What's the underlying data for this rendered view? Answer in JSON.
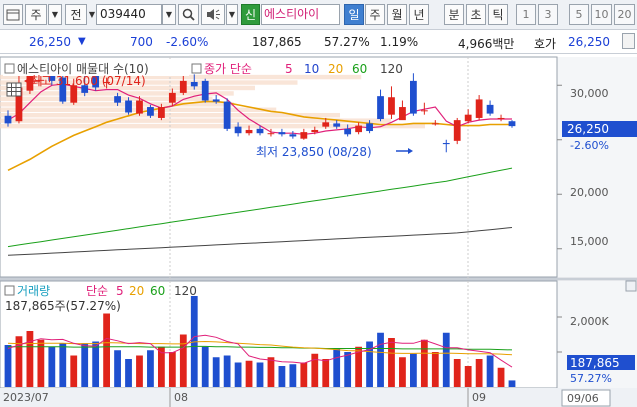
{
  "toolbar": {
    "chart_icon": "chart-window-icon",
    "type_label": "주",
    "period_label": "전",
    "code": "039440",
    "sin_label": "신",
    "stock_name": "에스티아이",
    "period_buttons": [
      "일",
      "주",
      "월",
      "년",
      "분",
      "초",
      "틱"
    ],
    "selected_period": "일",
    "number_buttons": [
      "1",
      "3",
      "5",
      "10",
      "20"
    ]
  },
  "quote": {
    "price": "26,250",
    "direction": "▼",
    "change": "700",
    "change_pct": "-2.60%",
    "volume": "187,865",
    "volume_ratio": "57.27%",
    "turnover_ratio": "1.19%",
    "amount": "4,966백만",
    "hoga_label": "호가",
    "hoga_price": "26,250"
  },
  "price_panel": {
    "legend_title": "에스티아이 매물대 수(10)",
    "ma_label": "종가 단순",
    "ma_periods": [
      "5",
      "10",
      "20",
      "60",
      "120"
    ],
    "high_label": "최고 31,600 (07/14)",
    "low_label": "최저 23,850 (08/28)",
    "y_ticks": [
      "30,000",
      "25,000",
      "20,000",
      "15,000"
    ],
    "current_price": "26,250",
    "current_pct": "-2.60%"
  },
  "volume_panel": {
    "legend_title": "거래량",
    "ma_label": "단순",
    "ma_periods": [
      "5",
      "20",
      "60",
      "120"
    ],
    "volume_text": "187,865주(57.27%)",
    "y_ticks": [
      "2,000K",
      "1,000K"
    ],
    "current_volume": "187,865",
    "current_pct": "57.27%"
  },
  "x_axis": {
    "labels": [
      "2023/07",
      "08",
      "09"
    ],
    "date_box": "09/06"
  },
  "colors": {
    "up": "#e0241b",
    "down": "#1f4fcf",
    "ma5": "#e0207a",
    "ma10": "#2244cc",
    "ma20": "#e8a000",
    "ma60": "#1aa01a",
    "ma120": "#444444"
  },
  "chart_data": {
    "type": "candlestick",
    "x": [
      "07/03",
      "07/04",
      "07/05",
      "07/06",
      "07/07",
      "07/10",
      "07/11",
      "07/12",
      "07/13",
      "07/14",
      "07/17",
      "07/18",
      "07/19",
      "07/20",
      "07/21",
      "07/24",
      "07/25",
      "07/26",
      "07/27",
      "07/28",
      "07/31",
      "08/01",
      "08/02",
      "08/03",
      "08/04",
      "08/07",
      "08/08",
      "08/09",
      "08/10",
      "08/11",
      "08/14",
      "08/16",
      "08/17",
      "08/18",
      "08/21",
      "08/22",
      "08/23",
      "08/24",
      "08/25",
      "08/28",
      "08/29",
      "08/30",
      "08/31",
      "09/01",
      "09/04",
      "09/05",
      "09/06"
    ],
    "open": [
      27200,
      26700,
      29500,
      30500,
      31200,
      30700,
      28400,
      30000,
      30900,
      30300,
      29000,
      28600,
      27400,
      28000,
      27000,
      28400,
      29300,
      30300,
      30400,
      28700,
      28500,
      26200,
      25600,
      26000,
      25600,
      25700,
      25500,
      25100,
      25700,
      26200,
      26500,
      26000,
      25700,
      26500,
      29000,
      27300,
      26800,
      30400,
      27700,
      26500,
      24700,
      24900,
      26700,
      27000,
      28200,
      26900,
      26700
    ],
    "close": [
      26500,
      29800,
      31000,
      30500,
      30400,
      28500,
      30000,
      29300,
      29800,
      30300,
      28400,
      27500,
      28600,
      27200,
      28000,
      29300,
      30400,
      29900,
      28600,
      28500,
      26000,
      25600,
      25900,
      25600,
      25600,
      25500,
      25300,
      25700,
      25900,
      26600,
      26200,
      25500,
      26300,
      25800,
      26900,
      28900,
      28000,
      27400,
      27700,
      26500,
      24600,
      26800,
      27300,
      28700,
      27400,
      27000,
      26250
    ],
    "high": [
      27700,
      31300,
      31400,
      30900,
      31600,
      31100,
      30600,
      31000,
      31000,
      30700,
      29300,
      28900,
      29000,
      28200,
      28300,
      29700,
      30900,
      31000,
      30600,
      29100,
      28800,
      26600,
      26300,
      26300,
      26000,
      26000,
      25800,
      26000,
      26200,
      27000,
      26800,
      26400,
      26600,
      26800,
      29600,
      29900,
      28600,
      31100,
      28400,
      26800,
      25000,
      27000,
      27800,
      29100,
      28600,
      27300,
      26800
    ],
    "low": [
      26200,
      26500,
      29200,
      29900,
      30000,
      28300,
      28200,
      29000,
      29500,
      29700,
      28100,
      27300,
      27200,
      27000,
      26800,
      28100,
      29100,
      29600,
      28400,
      28300,
      25800,
      25300,
      25400,
      25400,
      25300,
      25300,
      25100,
      25000,
      25500,
      26000,
      26000,
      25300,
      25500,
      25600,
      26700,
      26900,
      27700,
      27200,
      27300,
      26300,
      23850,
      24600,
      26500,
      26800,
      27200,
      26700,
      26100
    ],
    "ma5": [
      26800,
      27400,
      28400,
      29400,
      30000,
      30100,
      29900,
      29700,
      29500,
      29600,
      29600,
      29100,
      28800,
      28300,
      27900,
      28100,
      28700,
      29000,
      29200,
      29300,
      28700,
      27700,
      26900,
      26300,
      25700,
      25600,
      25600,
      25500,
      25600,
      25800,
      25900,
      26000,
      26200,
      26100,
      26200,
      26600,
      27100,
      27600,
      27800,
      28000,
      26700,
      26200,
      26600,
      26800,
      26900,
      26900,
      26900
    ],
    "ma20": [
      22200,
      22700,
      23200,
      23800,
      24400,
      24900,
      25400,
      25800,
      26200,
      26600,
      26900,
      27200,
      27500,
      27700,
      27900,
      28100,
      28300,
      28400,
      28500,
      28500,
      28400,
      28200,
      28000,
      27800,
      27600,
      27500,
      27300,
      27100,
      27000,
      26900,
      26800,
      26700,
      26600,
      26500,
      26400,
      26400,
      26400,
      26500,
      26500,
      26500,
      26400,
      26300,
      26300,
      26300,
      26400,
      26400,
      26400
    ],
    "ma60": [
      15200,
      15350,
      15500,
      15650,
      15800,
      15950,
      16100,
      16250,
      16400,
      16550,
      16700,
      16850,
      17000,
      17150,
      17300,
      17450,
      17600,
      17750,
      17900,
      18050,
      18200,
      18350,
      18500,
      18650,
      18800,
      18950,
      19100,
      19250,
      19400,
      19550,
      19700,
      19850,
      20000,
      20150,
      20300,
      20450,
      20600,
      20750,
      20900,
      21050,
      21200,
      21400,
      21600,
      21800,
      22000,
      22200,
      22400
    ],
    "ma120": [
      14400,
      14450,
      14500,
      14550,
      14600,
      14650,
      14700,
      14750,
      14800,
      14850,
      14900,
      14950,
      15000,
      15050,
      15100,
      15150,
      15200,
      15250,
      15300,
      15350,
      15400,
      15450,
      15500,
      15550,
      15600,
      15650,
      15700,
      15750,
      15800,
      15850,
      15900,
      15950,
      16000,
      16050,
      16100,
      16150,
      16200,
      16250,
      16300,
      16350,
      16400,
      16450,
      16550,
      16650,
      16750,
      16850,
      16950
    ],
    "volume": [
      1200,
      1450,
      1600,
      1350,
      1150,
      1250,
      900,
      1250,
      1300,
      2100,
      1050,
      800,
      900,
      1050,
      1150,
      1000,
      1500,
      2600,
      1150,
      850,
      900,
      700,
      750,
      700,
      850,
      600,
      650,
      700,
      950,
      800,
      1100,
      1000,
      1150,
      1300,
      1550,
      1400,
      850,
      950,
      1350,
      1000,
      1550,
      800,
      600,
      800,
      900,
      550,
      188
    ],
    "vol_ma5": [
      1100,
      1200,
      1300,
      1380,
      1350,
      1360,
      1250,
      1180,
      1170,
      1390,
      1320,
      1240,
      1270,
      1240,
      980,
      980,
      1120,
      1440,
      1480,
      1420,
      1300,
      1230,
      890,
      800,
      770,
      720,
      710,
      680,
      790,
      750,
      840,
      910,
      1000,
      1070,
      1220,
      1280,
      1250,
      1250,
      1340,
      1230,
      1120,
      1120,
      1060,
      1020,
      980,
      770,
      570
    ],
    "vol_ma20": [
      1250,
      1240,
      1240,
      1250,
      1250,
      1250,
      1240,
      1240,
      1240,
      1270,
      1260,
      1250,
      1240,
      1240,
      1240,
      1230,
      1230,
      1290,
      1300,
      1290,
      1270,
      1250,
      1230,
      1210,
      1200,
      1170,
      1140,
      1120,
      1110,
      1090,
      1070,
      1040,
      1030,
      1010,
      990,
      970,
      960,
      960,
      970,
      960,
      970,
      960,
      950,
      950,
      950,
      940,
      920
    ],
    "vol_ma60": [
      1150,
      1150,
      1150,
      1150,
      1150,
      1150,
      1140,
      1140,
      1140,
      1150,
      1150,
      1150,
      1150,
      1140,
      1140,
      1140,
      1140,
      1160,
      1160,
      1150,
      1150,
      1140,
      1140,
      1130,
      1130,
      1120,
      1120,
      1110,
      1110,
      1100,
      1100,
      1100,
      1100,
      1100,
      1100,
      1100,
      1090,
      1090,
      1090,
      1090,
      1090,
      1090,
      1080,
      1080,
      1080,
      1070,
      1060
    ],
    "ylim_price": [
      12500,
      32500
    ],
    "ylim_volume": [
      0,
      3000
    ],
    "volume_profile": [
      {
        "lo": 30500,
        "hi": 31000,
        "value": 0.85
      },
      {
        "lo": 30000,
        "hi": 30500,
        "value": 0.7
      },
      {
        "lo": 29500,
        "hi": 30000,
        "value": 0.6
      },
      {
        "lo": 29000,
        "hi": 29500,
        "value": 0.55
      },
      {
        "lo": 28500,
        "hi": 29000,
        "value": 0.5
      },
      {
        "lo": 28000,
        "hi": 28500,
        "value": 0.55
      },
      {
        "lo": 27500,
        "hi": 28000,
        "value": 0.65
      },
      {
        "lo": 27000,
        "hi": 27500,
        "value": 0.8
      },
      {
        "lo": 26500,
        "hi": 27000,
        "value": 0.92
      },
      {
        "lo": 26000,
        "hi": 26500,
        "value": 1.0
      }
    ]
  }
}
